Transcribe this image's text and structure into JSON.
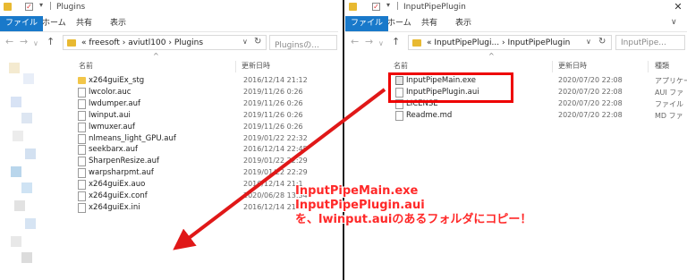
{
  "left_window": {
    "title": "Plugins",
    "tabs": [
      "ファイル",
      "ホーム",
      "共有",
      "表示"
    ],
    "breadcrumb": [
      "freesoft",
      "aviutl100",
      "Plugins"
    ],
    "search_placeholder": "Pluginsの...",
    "columns": {
      "name": "名前",
      "date": "更新日時"
    },
    "files": [
      {
        "name": "x264guiEx_stg",
        "date": "2016/12/14 21:12",
        "icon": "folder-icon"
      },
      {
        "name": "lwcolor.auc",
        "date": "2019/11/26 0:26",
        "icon": "document-icon"
      },
      {
        "name": "lwdumper.auf",
        "date": "2019/11/26 0:26",
        "icon": "document-icon"
      },
      {
        "name": "lwinput.aui",
        "date": "2019/11/26 0:26",
        "icon": "document-icon"
      },
      {
        "name": "lwmuxer.auf",
        "date": "2019/11/26 0:26",
        "icon": "document-icon"
      },
      {
        "name": "nlmeans_light_GPU.auf",
        "date": "2019/01/22 22:32",
        "icon": "document-icon"
      },
      {
        "name": "seekbarx.auf",
        "date": "2016/12/14 22:45",
        "icon": "document-icon"
      },
      {
        "name": "SharpenResize.auf",
        "date": "2019/01/22 22:29",
        "icon": "document-icon"
      },
      {
        "name": "warpsharpmt.auf",
        "date": "2019/01/22 22:29",
        "icon": "document-icon"
      },
      {
        "name": "x264guiEx.auo",
        "date": "2016/12/14 21:1",
        "icon": "document-icon"
      },
      {
        "name": "x264guiEx.conf",
        "date": "2020/06/28 13:34",
        "icon": "document-icon"
      },
      {
        "name": "x264guiEx.ini",
        "date": "2016/12/14 21:11",
        "icon": "document-icon"
      }
    ]
  },
  "right_window": {
    "title": "InputPipePlugin",
    "tabs": [
      "ファイル",
      "ホーム",
      "共有",
      "表示"
    ],
    "breadcrumb": [
      "InputPipePlugi...",
      "InputPipePlugin"
    ],
    "search_placeholder": "InputPipe...",
    "columns": {
      "name": "名前",
      "date": "更新日時",
      "type": "種類"
    },
    "files": [
      {
        "name": "InputPipeMain.exe",
        "date": "2020/07/20 22:08",
        "type": "アプリケー",
        "icon": "exe-icon"
      },
      {
        "name": "InputPipePlugin.aui",
        "date": "2020/07/20 22:08",
        "type": "AUI ファ",
        "icon": "document-icon"
      },
      {
        "name": "LICENSE",
        "date": "2020/07/20 22:08",
        "type": "ファイル",
        "icon": "document-icon"
      },
      {
        "name": "Readme.md",
        "date": "2020/07/20 22:08",
        "type": "MD ファ",
        "icon": "document-icon"
      }
    ]
  },
  "annotation": {
    "lines": [
      "InputPipeMain.exe",
      "InputPipePlugin.aui",
      "を、lwinput.auiのあるフォルダにコピー！"
    ],
    "color": "#ff2828"
  },
  "colors": {
    "file_tab": "#1979ca",
    "folder": "#f2c64a",
    "highlight": "#e00000"
  }
}
